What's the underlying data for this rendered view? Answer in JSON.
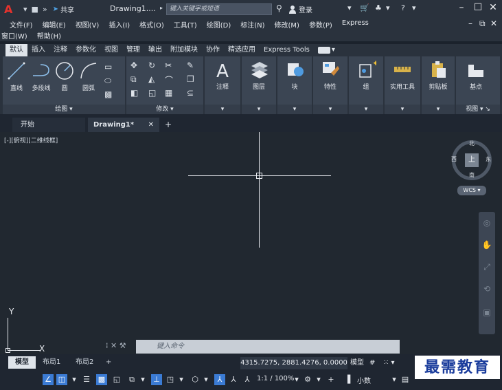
{
  "titlebar": {
    "share_label": "共享",
    "doc_title": "Drawing1....",
    "search_placeholder": "键入关键字或短语",
    "login_label": "登录"
  },
  "menu": {
    "row1": [
      "文件(F)",
      "编辑(E)",
      "视图(V)",
      "插入(I)",
      "格式(O)",
      "工具(T)",
      "绘图(D)",
      "标注(N)",
      "修改(M)",
      "参数(P)",
      "Express"
    ],
    "row2": [
      "窗口(W)",
      "帮助(H)"
    ]
  },
  "ribbon_tabs": [
    "默认",
    "插入",
    "注释",
    "参数化",
    "视图",
    "管理",
    "输出",
    "附加模块",
    "协作",
    "精选应用",
    "Express Tools"
  ],
  "ribbon": {
    "draw_tools": [
      "直线",
      "多段线",
      "圆",
      "圆弧"
    ],
    "draw_panel": "绘图",
    "modify_panel": "修改",
    "big_tools": [
      "注释",
      "图层",
      "块",
      "特性",
      "组",
      "实用工具",
      "剪贴板",
      "基点"
    ],
    "view_panel": "视图"
  },
  "file_tabs": {
    "start": "开始",
    "doc": "Drawing1*"
  },
  "viewport": {
    "label": "[-][俯视][二维线框]",
    "compass": {
      "north": "北",
      "south": "南",
      "east": "东",
      "west": "西",
      "center": "上"
    },
    "wcs": "WCS",
    "ucs_x": "X",
    "ucs_y": "Y",
    "command_placeholder": "键入命令"
  },
  "layout_tabs": [
    "模型",
    "布局1",
    "布局2"
  ],
  "status": {
    "coords": "4315.7275, 2881.4276, 0.0000",
    "mode": "模型",
    "scale": "1:1 / 100%",
    "units": "小数"
  },
  "watermark": "最需教育"
}
